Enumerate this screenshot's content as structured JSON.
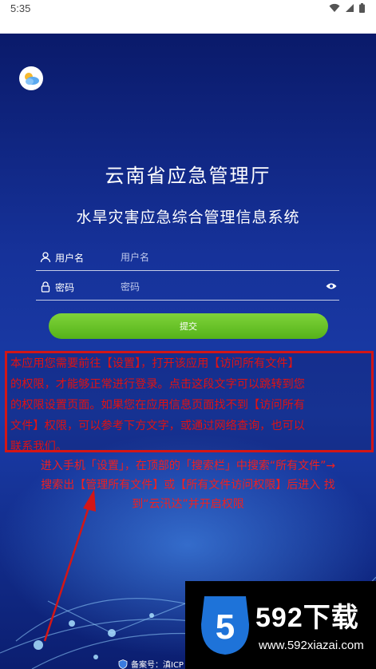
{
  "status_bar": {
    "time": "5:35"
  },
  "header": {
    "title": "云南省应急管理厅",
    "subtitle": "水旱灾害应急综合管理信息系统"
  },
  "form": {
    "username_label": "用户名",
    "username_placeholder": "用户名",
    "password_label": "密码",
    "password_placeholder": "密码",
    "submit_label": "提交"
  },
  "notice": {
    "line1": "本应用您需要前往【设置】，打开该应用【访问所有文件】",
    "line2": "的权限，才能够正常进行登录。点击这段文字可以跳转到您",
    "line3": "的权限设置页面。如果您在应用信息页面找不到【访问所有",
    "line4": "文件】权限，可以参考下方文字，或通过网络查询，也可以",
    "line5": "联系我们。"
  },
  "instruction": {
    "line1": "进入手机「设置」，在顶部的「搜索栏」中搜索“所有文件”→",
    "line2": "搜索出【管理所有文件】或【所有文件访问权限】后进入 找",
    "line3": "到“云汛达”并开启权限"
  },
  "footer": {
    "text": "备案号：滇ICP"
  },
  "watermark": {
    "brand": "592下载",
    "url": "www.592xiazai.com"
  },
  "colors": {
    "accent_green": "#5bb81e",
    "notice_red": "#d31616",
    "background_blue": "#1a3ca8"
  }
}
